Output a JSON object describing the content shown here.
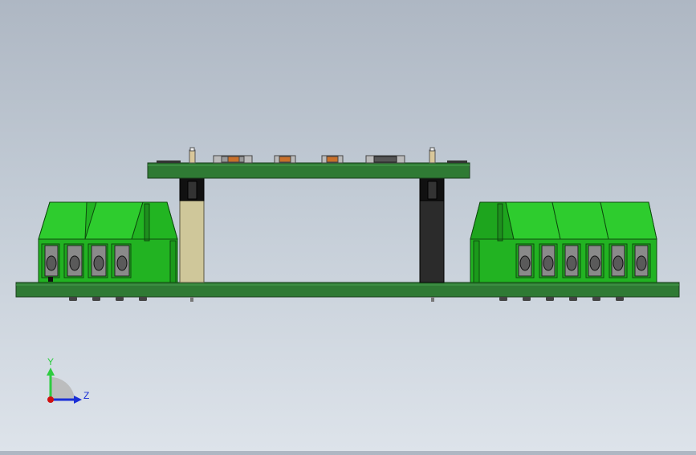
{
  "viewport": {
    "background_top": "#aeb7c3",
    "background_bottom": "#dde3ea"
  },
  "triad": {
    "y_label": "Y",
    "z_label": "Z",
    "y_color": "#2ecc40",
    "z_color": "#1a2fd6",
    "x_color": "#d01010"
  },
  "model": {
    "board_color": "#2e7d32",
    "terminal_color": "#22b822",
    "left_standoff_color": "#cfc79a",
    "right_standoff_color": "#2a2a2a"
  }
}
